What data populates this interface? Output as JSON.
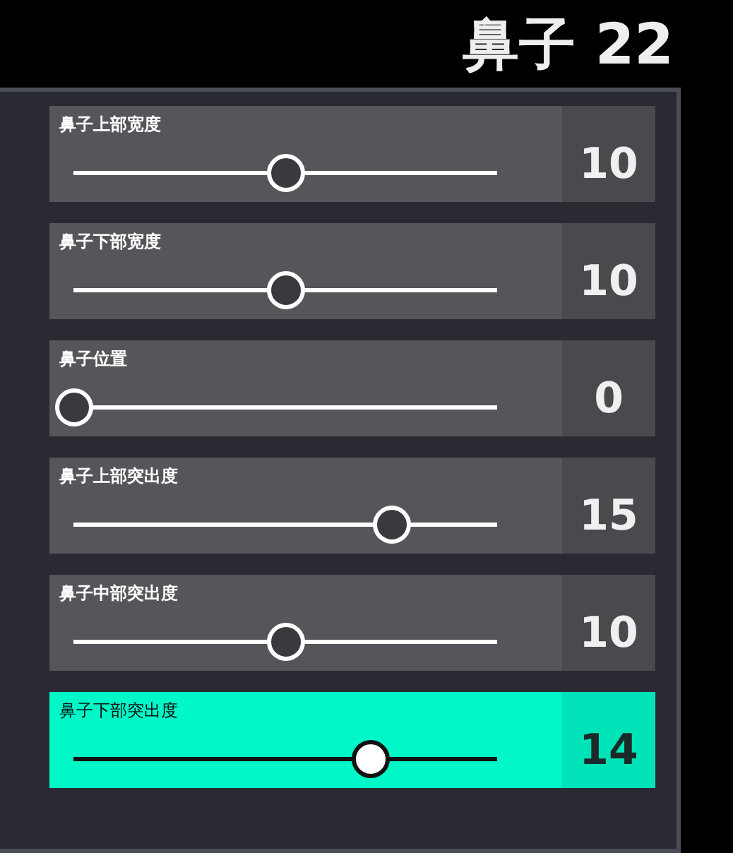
{
  "title": "鼻子 22",
  "sliders": [
    {
      "label": "鼻子上部宽度",
      "value": "10",
      "level": 0.5,
      "selected": false
    },
    {
      "label": "鼻子下部宽度",
      "value": "10",
      "level": 0.5,
      "selected": false
    },
    {
      "label": "鼻子位置",
      "value": "0",
      "level": 0,
      "selected": false
    },
    {
      "label": "鼻子上部突出度",
      "value": "15",
      "level": 0.75,
      "selected": false
    },
    {
      "label": "鼻子中部突出度",
      "value": "10",
      "level": 0.5,
      "selected": false
    },
    {
      "label": "鼻子下部突出度",
      "value": "14",
      "level": 0.7,
      "selected": true
    }
  ]
}
